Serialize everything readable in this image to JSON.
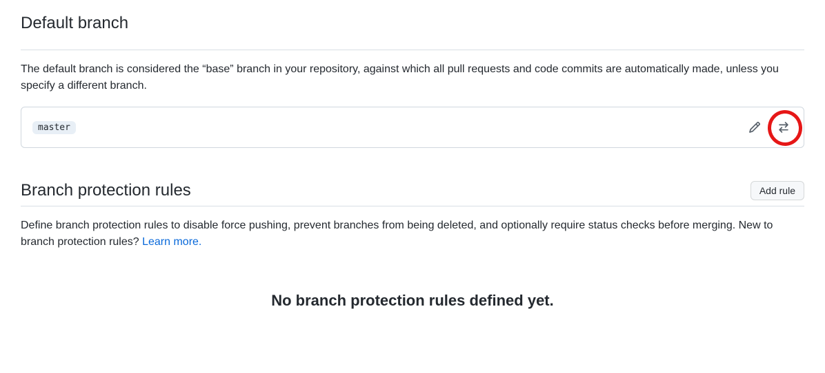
{
  "defaultBranch": {
    "heading": "Default branch",
    "description": "The default branch is considered the “base” branch in your repository, against which all pull requests and code commits are automatically made, unless you specify a different branch.",
    "branchName": "master"
  },
  "protectionRules": {
    "heading": "Branch protection rules",
    "addButton": "Add rule",
    "description": "Define branch protection rules to disable force pushing, prevent branches from being deleted, and optionally require status checks before merging. New to branch protection rules? ",
    "learnMore": "Learn more.",
    "emptyState": "No branch protection rules defined yet."
  }
}
